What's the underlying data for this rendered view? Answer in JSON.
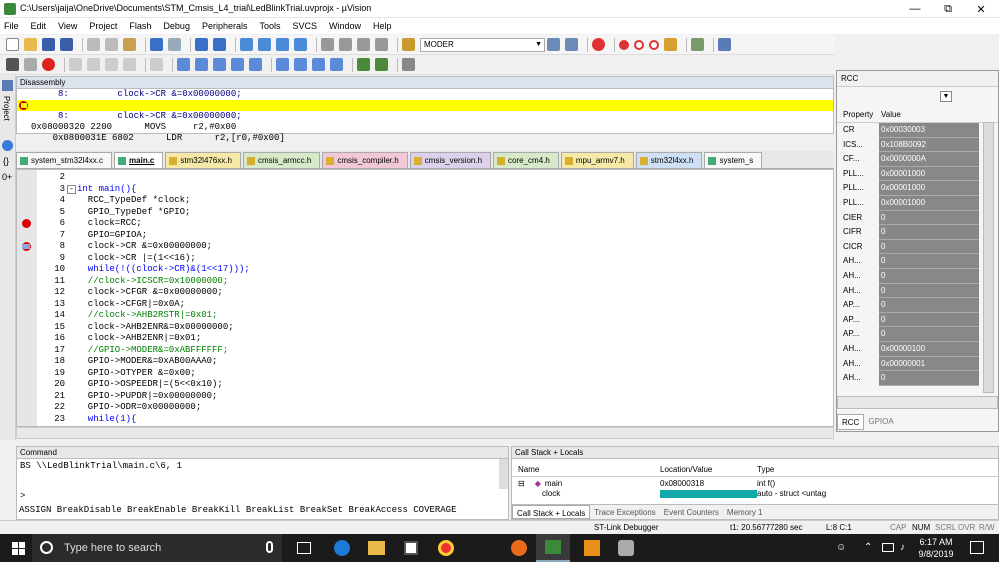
{
  "window": {
    "title": "C:\\Users\\jaija\\OneDrive\\Documents\\STM_Cmsis_L4_trial\\LedBlinkTrial.uvprojx - µVision"
  },
  "menu": [
    "File",
    "Edit",
    "View",
    "Project",
    "Flash",
    "Debug",
    "Peripherals",
    "Tools",
    "SVCS",
    "Window",
    "Help"
  ],
  "toolbar": {
    "target": "MODER"
  },
  "disassembly": {
    "title": "Disassembly",
    "lines": [
      "     8:         clock->CR &=0x00000000;",
      "0x0800031E 6802      LDR      r2,[r0,#0x00]",
      "     8:         clock->CR &=0x00000000;",
      "0x08000320 2200      MOVS     r2,#0x00"
    ]
  },
  "project_tab": "Project",
  "tabs": [
    "system_stm32l4xx.c",
    "main.c",
    "stm32l476xx.h",
    "cmsis_armcc.h",
    "cmsis_compiler.h",
    "cmsis_version.h",
    "core_cm4.h",
    "mpu_armv7.h",
    "stm32l4xx.h",
    "system_s"
  ],
  "code": [
    {
      "n": "2",
      "t": ""
    },
    {
      "n": "3",
      "t": "int main(){"
    },
    {
      "n": "4",
      "t": "  RCC_TypeDef *clock;"
    },
    {
      "n": "5",
      "t": "  GPIO_TypeDef *GPIO;"
    },
    {
      "n": "6",
      "t": "  clock=RCC;"
    },
    {
      "n": "7",
      "t": "  GPIO=GPIOA;"
    },
    {
      "n": "8",
      "t": "  clock->CR &=0x00000000;"
    },
    {
      "n": "9",
      "t": "  clock->CR |=(1<<16);"
    },
    {
      "n": "10",
      "t": "  while(!((clock->CR)&(1<<17)));"
    },
    {
      "n": "11",
      "t": "  //clock->ICSCR=0x10000000;"
    },
    {
      "n": "12",
      "t": "  clock->CFGR &=0x00000000;"
    },
    {
      "n": "13",
      "t": "  clock->CFGR|=0x0A;"
    },
    {
      "n": "14",
      "t": "  //clock->AHB2RSTR|=0x01;"
    },
    {
      "n": "15",
      "t": "  clock->AHB2ENR&=0x00000000;"
    },
    {
      "n": "16",
      "t": "  clock->AHB2ENR|=0x01;"
    },
    {
      "n": "17",
      "t": "  //GPIO->MODER&=0xABFFFFFF;"
    },
    {
      "n": "18",
      "t": "  GPIO->MODER&=0xAB00AAA0;"
    },
    {
      "n": "19",
      "t": "  GPIO->OTYPER &=0x00;"
    },
    {
      "n": "20",
      "t": "  GPIO->OSPEEDR|=(5<<0x10);"
    },
    {
      "n": "21",
      "t": "  GPIO->PUPDR|=0x00000000;"
    },
    {
      "n": "22",
      "t": "  GPIO->ODR=0x00000000;"
    },
    {
      "n": "23",
      "t": "  while(1){"
    }
  ],
  "rcc": {
    "title": "RCC",
    "col_property": "Property",
    "col_value": "Value",
    "rows": [
      {
        "p": "CR",
        "v": "0x00030003"
      },
      {
        "p": "ICS...",
        "v": "0x108B0092"
      },
      {
        "p": "CF...",
        "v": "0x0000000A"
      },
      {
        "p": "PLL...",
        "v": "0x00001000"
      },
      {
        "p": "PLL...",
        "v": "0x00001000"
      },
      {
        "p": "PLL...",
        "v": "0x00001000"
      },
      {
        "p": "CIER",
        "v": "0"
      },
      {
        "p": "CIFR",
        "v": "0"
      },
      {
        "p": "CICR",
        "v": "0"
      },
      {
        "p": "AH...",
        "v": "0"
      },
      {
        "p": "AH...",
        "v": "0"
      },
      {
        "p": "AH...",
        "v": "0"
      },
      {
        "p": "AP...",
        "v": "0"
      },
      {
        "p": "AP...",
        "v": "0"
      },
      {
        "p": "AP...",
        "v": "0"
      },
      {
        "p": "AH...",
        "v": "0x00000100"
      },
      {
        "p": "AH...",
        "v": "0x00000001"
      },
      {
        "p": "AH...",
        "v": "0"
      }
    ],
    "tabs": [
      "RCC",
      "GPIOA"
    ]
  },
  "command": {
    "title": "Command",
    "line": "BS \\\\LedBlinkTrial\\main.c\\6, 1",
    "prompt": ">",
    "hint": "ASSIGN BreakDisable BreakEnable BreakKill BreakList BreakSet BreakAccess COVERAGE"
  },
  "callstack": {
    "title": "Call Stack + Locals",
    "cols": [
      "Name",
      "Location/Value",
      "Type"
    ],
    "row_name": "main",
    "row_loc": "0x08000318",
    "row_type": "int f()",
    "row2_name": "clock",
    "row2_type": "auto - struct <untag",
    "tabs": [
      "Call Stack + Locals",
      "Trace Exceptions",
      "Event Counters",
      "Memory 1"
    ]
  },
  "status": {
    "debugger": "ST-Link Debugger",
    "time": "t1: 20.56777280 sec",
    "pos": "L:8 C:1",
    "caps": "CAP",
    "num": "NUM",
    "scrl": "SCRL",
    "ovr": "OVR",
    "rw": "R/W"
  },
  "taskbar": {
    "search": "Type here to search",
    "time": "6:17 AM",
    "date": "9/8/2019"
  }
}
